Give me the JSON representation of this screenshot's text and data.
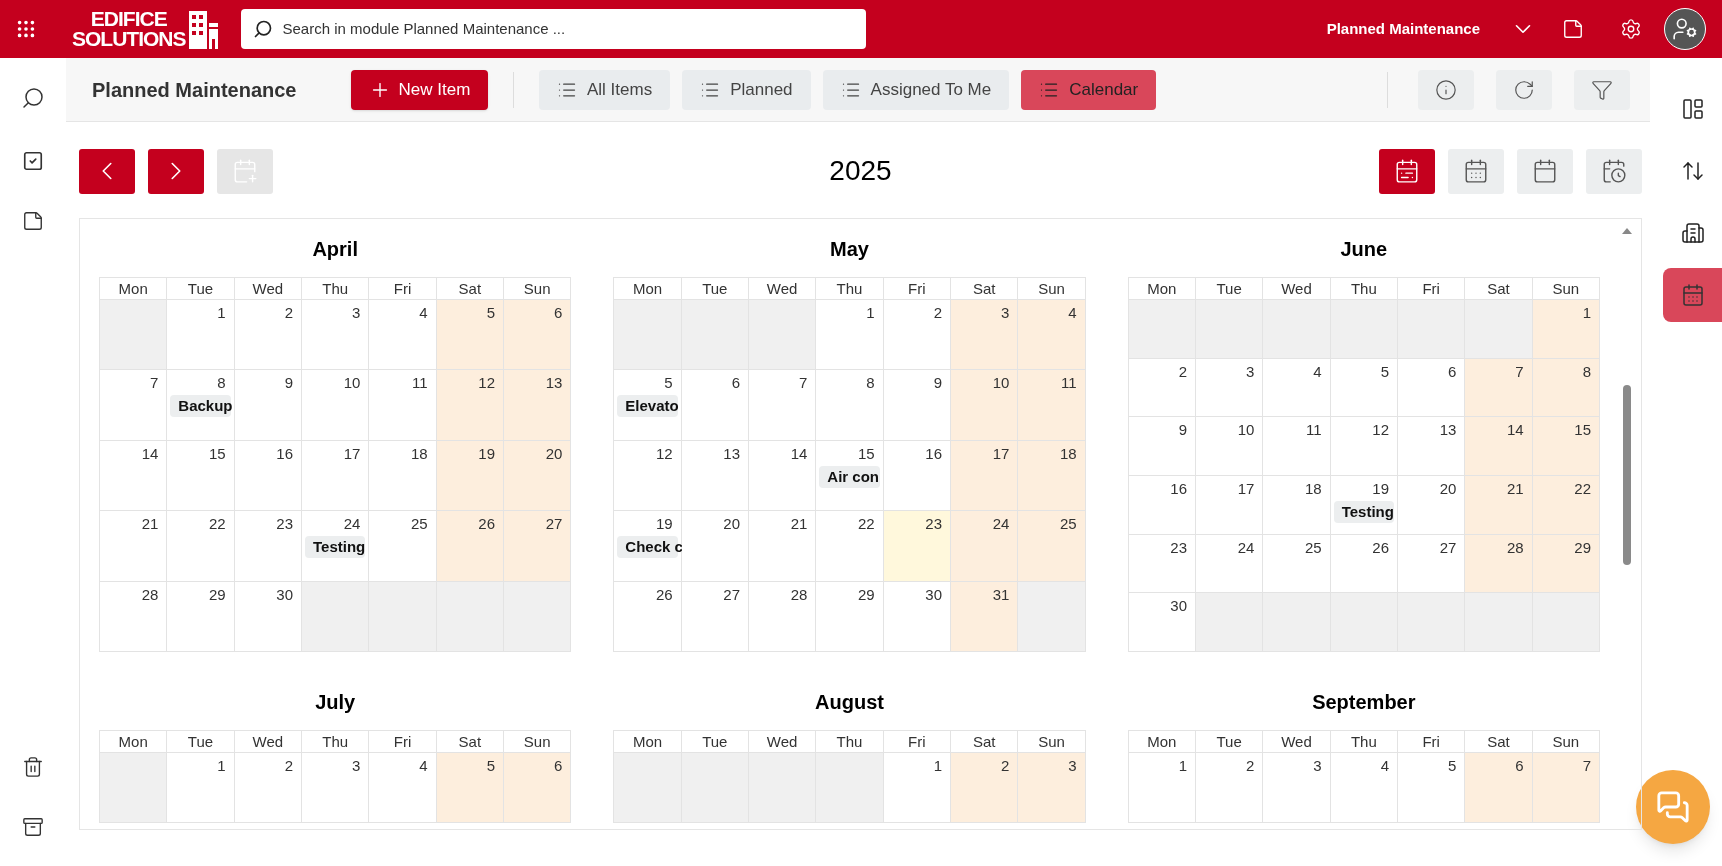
{
  "header": {
    "logo": [
      "EDIFICE",
      "SOLUTIONS"
    ],
    "search": {
      "placeholder": "Search in module Planned Maintenance ..."
    },
    "module": "Planned Maintenance"
  },
  "toolbar": {
    "title": "Planned Maintenance",
    "new_button": "New Item",
    "tabs": [
      {
        "label": "All Items",
        "selected": false
      },
      {
        "label": "Planned",
        "selected": false
      },
      {
        "label": "Assigned To Me",
        "selected": false
      },
      {
        "label": "Calendar",
        "selected": true
      }
    ]
  },
  "right_sidebar": [
    {
      "kind": "layout",
      "selected": false
    },
    {
      "kind": "sort",
      "selected": false
    },
    {
      "kind": "building",
      "selected": false
    },
    {
      "kind": "calendar",
      "selected": true
    }
  ],
  "calendar": {
    "year": "2025",
    "views": [
      {
        "kind": "range",
        "selected": true
      },
      {
        "kind": "month",
        "selected": false
      },
      {
        "kind": "week",
        "selected": false
      },
      {
        "kind": "day",
        "selected": false
      }
    ],
    "months": [
      {
        "name": "April",
        "weekdays": [
          "Mon",
          "Tue",
          "Wed",
          "Thu",
          "Fri",
          "Sat",
          "Sun"
        ],
        "weeks": [
          [
            {
              "kind": "blank"
            },
            {
              "kind": "weekday",
              "day": "1"
            },
            {
              "kind": "weekday",
              "day": "2"
            },
            {
              "kind": "weekday",
              "day": "3"
            },
            {
              "kind": "weekday",
              "day": "4"
            },
            {
              "kind": "weekend",
              "day": "5"
            },
            {
              "kind": "weekend",
              "day": "6"
            }
          ],
          [
            {
              "kind": "weekday",
              "day": "7"
            },
            {
              "kind": "weekday",
              "day": "8",
              "event": "Backup"
            },
            {
              "kind": "weekday",
              "day": "9"
            },
            {
              "kind": "weekday",
              "day": "10"
            },
            {
              "kind": "weekday",
              "day": "11"
            },
            {
              "kind": "weekend",
              "day": "12"
            },
            {
              "kind": "weekend",
              "day": "13"
            }
          ],
          [
            {
              "kind": "weekday",
              "day": "14"
            },
            {
              "kind": "weekday",
              "day": "15"
            },
            {
              "kind": "weekday",
              "day": "16"
            },
            {
              "kind": "weekday",
              "day": "17"
            },
            {
              "kind": "weekday",
              "day": "18"
            },
            {
              "kind": "weekend",
              "day": "19"
            },
            {
              "kind": "weekend",
              "day": "20"
            }
          ],
          [
            {
              "kind": "weekday",
              "day": "21"
            },
            {
              "kind": "weekday",
              "day": "22"
            },
            {
              "kind": "weekday",
              "day": "23"
            },
            {
              "kind": "weekday",
              "day": "24",
              "event": "Testing"
            },
            {
              "kind": "weekday",
              "day": "25"
            },
            {
              "kind": "weekend",
              "day": "26"
            },
            {
              "kind": "weekend",
              "day": "27"
            }
          ],
          [
            {
              "kind": "weekday",
              "day": "28"
            },
            {
              "kind": "weekday",
              "day": "29"
            },
            {
              "kind": "weekday",
              "day": "30"
            },
            {
              "kind": "blank"
            },
            {
              "kind": "blank"
            },
            {
              "kind": "blank"
            },
            {
              "kind": "blank"
            }
          ]
        ]
      },
      {
        "name": "May",
        "weekdays": [
          "Mon",
          "Tue",
          "Wed",
          "Thu",
          "Fri",
          "Sat",
          "Sun"
        ],
        "weeks": [
          [
            {
              "kind": "blank"
            },
            {
              "kind": "blank"
            },
            {
              "kind": "blank"
            },
            {
              "kind": "weekday",
              "day": "1"
            },
            {
              "kind": "weekday",
              "day": "2"
            },
            {
              "kind": "weekend",
              "day": "3"
            },
            {
              "kind": "weekend",
              "day": "4"
            }
          ],
          [
            {
              "kind": "weekday",
              "day": "5",
              "event": "Elevato"
            },
            {
              "kind": "weekday",
              "day": "6"
            },
            {
              "kind": "weekday",
              "day": "7"
            },
            {
              "kind": "weekday",
              "day": "8"
            },
            {
              "kind": "weekday",
              "day": "9"
            },
            {
              "kind": "weekend",
              "day": "10"
            },
            {
              "kind": "weekend",
              "day": "11"
            }
          ],
          [
            {
              "kind": "weekday",
              "day": "12"
            },
            {
              "kind": "weekday",
              "day": "13"
            },
            {
              "kind": "weekday",
              "day": "14"
            },
            {
              "kind": "weekday",
              "day": "15",
              "event": "Air con"
            },
            {
              "kind": "weekday",
              "day": "16"
            },
            {
              "kind": "weekend",
              "day": "17"
            },
            {
              "kind": "weekend",
              "day": "18"
            }
          ],
          [
            {
              "kind": "weekday",
              "day": "19",
              "event": "Check c"
            },
            {
              "kind": "weekday",
              "day": "20"
            },
            {
              "kind": "weekday",
              "day": "21"
            },
            {
              "kind": "weekday",
              "day": "22"
            },
            {
              "kind": "today",
              "day": "23"
            },
            {
              "kind": "weekend",
              "day": "24"
            },
            {
              "kind": "weekend",
              "day": "25"
            }
          ],
          [
            {
              "kind": "weekday",
              "day": "26"
            },
            {
              "kind": "weekday",
              "day": "27"
            },
            {
              "kind": "weekday",
              "day": "28"
            },
            {
              "kind": "weekday",
              "day": "29"
            },
            {
              "kind": "weekday",
              "day": "30"
            },
            {
              "kind": "weekend",
              "day": "31"
            },
            {
              "kind": "blank"
            }
          ]
        ]
      },
      {
        "name": "June",
        "weekdays": [
          "Mon",
          "Tue",
          "Wed",
          "Thu",
          "Fri",
          "Sat",
          "Sun"
        ],
        "weeks": [
          [
            {
              "kind": "blank"
            },
            {
              "kind": "blank"
            },
            {
              "kind": "blank"
            },
            {
              "kind": "blank"
            },
            {
              "kind": "blank"
            },
            {
              "kind": "blank"
            },
            {
              "kind": "weekend",
              "day": "1"
            }
          ],
          [
            {
              "kind": "weekday",
              "day": "2"
            },
            {
              "kind": "weekday",
              "day": "3"
            },
            {
              "kind": "weekday",
              "day": "4"
            },
            {
              "kind": "weekday",
              "day": "5"
            },
            {
              "kind": "weekday",
              "day": "6"
            },
            {
              "kind": "weekend",
              "day": "7"
            },
            {
              "kind": "weekend",
              "day": "8"
            }
          ],
          [
            {
              "kind": "weekday",
              "day": "9"
            },
            {
              "kind": "weekday",
              "day": "10"
            },
            {
              "kind": "weekday",
              "day": "11"
            },
            {
              "kind": "weekday",
              "day": "12"
            },
            {
              "kind": "weekday",
              "day": "13"
            },
            {
              "kind": "weekend",
              "day": "14"
            },
            {
              "kind": "weekend",
              "day": "15"
            }
          ],
          [
            {
              "kind": "weekday",
              "day": "16"
            },
            {
              "kind": "weekday",
              "day": "17"
            },
            {
              "kind": "weekday",
              "day": "18"
            },
            {
              "kind": "weekday",
              "day": "19",
              "event": "Testing"
            },
            {
              "kind": "weekday",
              "day": "20"
            },
            {
              "kind": "weekend",
              "day": "21"
            },
            {
              "kind": "weekend",
              "day": "22"
            }
          ],
          [
            {
              "kind": "weekday",
              "day": "23"
            },
            {
              "kind": "weekday",
              "day": "24"
            },
            {
              "kind": "weekday",
              "day": "25"
            },
            {
              "kind": "weekday",
              "day": "26"
            },
            {
              "kind": "weekday",
              "day": "27"
            },
            {
              "kind": "weekend",
              "day": "28"
            },
            {
              "kind": "weekend",
              "day": "29"
            }
          ],
          [
            {
              "kind": "weekday",
              "day": "30"
            },
            {
              "kind": "blank"
            },
            {
              "kind": "blank"
            },
            {
              "kind": "blank"
            },
            {
              "kind": "blank"
            },
            {
              "kind": "blank"
            },
            {
              "kind": "blank"
            }
          ]
        ]
      },
      {
        "name": "July",
        "weekdays": [
          "Mon",
          "Tue",
          "Wed",
          "Thu",
          "Fri",
          "Sat",
          "Sun"
        ],
        "weeks": [
          [
            {
              "kind": "blank"
            },
            {
              "kind": "weekday",
              "day": "1"
            },
            {
              "kind": "weekday",
              "day": "2"
            },
            {
              "kind": "weekday",
              "day": "3"
            },
            {
              "kind": "weekday",
              "day": "4"
            },
            {
              "kind": "weekend",
              "day": "5"
            },
            {
              "kind": "weekend",
              "day": "6"
            }
          ]
        ]
      },
      {
        "name": "August",
        "weekdays": [
          "Mon",
          "Tue",
          "Wed",
          "Thu",
          "Fri",
          "Sat",
          "Sun"
        ],
        "weeks": [
          [
            {
              "kind": "blank"
            },
            {
              "kind": "blank"
            },
            {
              "kind": "blank"
            },
            {
              "kind": "blank"
            },
            {
              "kind": "weekday",
              "day": "1"
            },
            {
              "kind": "weekend",
              "day": "2"
            },
            {
              "kind": "weekend",
              "day": "3"
            }
          ]
        ]
      },
      {
        "name": "September",
        "weekdays": [
          "Mon",
          "Tue",
          "Wed",
          "Thu",
          "Fri",
          "Sat",
          "Sun"
        ],
        "weeks": [
          [
            {
              "kind": "weekday",
              "day": "1"
            },
            {
              "kind": "weekday",
              "day": "2"
            },
            {
              "kind": "weekday",
              "day": "3"
            },
            {
              "kind": "weekday",
              "day": "4"
            },
            {
              "kind": "weekday",
              "day": "5"
            },
            {
              "kind": "weekend",
              "day": "6"
            },
            {
              "kind": "weekend",
              "day": "7"
            }
          ]
        ]
      }
    ]
  }
}
